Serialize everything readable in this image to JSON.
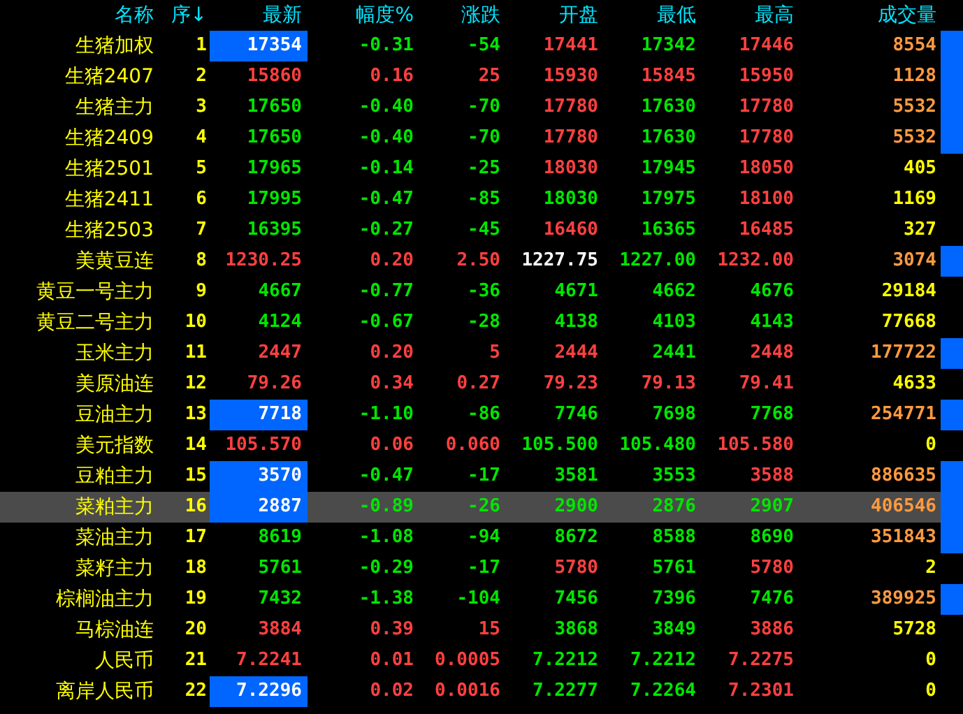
{
  "columns": [
    "名称",
    "序↓",
    "最新",
    "幅度%",
    "涨跌",
    "开盘",
    "最低",
    "最高",
    "成交量"
  ],
  "rows": [
    {
      "name": "生猪加权",
      "seq": "1",
      "latest_highlight": true,
      "volume_bar": true,
      "selected": false,
      "cells": [
        {
          "text": "17354",
          "color": "#ffffff"
        },
        {
          "text": "-0.31",
          "color": "#00e600"
        },
        {
          "text": "-54",
          "color": "#00e600"
        },
        {
          "text": "17441",
          "color": "#ff4040"
        },
        {
          "text": "17342",
          "color": "#00e600"
        },
        {
          "text": "17446",
          "color": "#ff4040"
        },
        {
          "text": "8554",
          "color": "#ff9a40"
        }
      ]
    },
    {
      "name": "生猪2407",
      "seq": "2",
      "latest_highlight": false,
      "volume_bar": true,
      "selected": false,
      "cells": [
        {
          "text": "15860",
          "color": "#ff4040"
        },
        {
          "text": "0.16",
          "color": "#ff4040"
        },
        {
          "text": "25",
          "color": "#ff4040"
        },
        {
          "text": "15930",
          "color": "#ff4040"
        },
        {
          "text": "15845",
          "color": "#ff4040"
        },
        {
          "text": "15950",
          "color": "#ff4040"
        },
        {
          "text": "1128",
          "color": "#ff9a40"
        }
      ]
    },
    {
      "name": "生猪主力",
      "seq": "3",
      "latest_highlight": false,
      "volume_bar": true,
      "selected": false,
      "cells": [
        {
          "text": "17650",
          "color": "#00e600"
        },
        {
          "text": "-0.40",
          "color": "#00e600"
        },
        {
          "text": "-70",
          "color": "#00e600"
        },
        {
          "text": "17780",
          "color": "#ff4040"
        },
        {
          "text": "17630",
          "color": "#00e600"
        },
        {
          "text": "17780",
          "color": "#ff4040"
        },
        {
          "text": "5532",
          "color": "#ff9a40"
        }
      ]
    },
    {
      "name": "生猪2409",
      "seq": "4",
      "latest_highlight": false,
      "volume_bar": true,
      "selected": false,
      "cells": [
        {
          "text": "17650",
          "color": "#00e600"
        },
        {
          "text": "-0.40",
          "color": "#00e600"
        },
        {
          "text": "-70",
          "color": "#00e600"
        },
        {
          "text": "17780",
          "color": "#ff4040"
        },
        {
          "text": "17630",
          "color": "#00e600"
        },
        {
          "text": "17780",
          "color": "#ff4040"
        },
        {
          "text": "5532",
          "color": "#ff9a40"
        }
      ]
    },
    {
      "name": "生猪2501",
      "seq": "5",
      "latest_highlight": false,
      "volume_bar": false,
      "selected": false,
      "cells": [
        {
          "text": "17965",
          "color": "#00e600"
        },
        {
          "text": "-0.14",
          "color": "#00e600"
        },
        {
          "text": "-25",
          "color": "#00e600"
        },
        {
          "text": "18030",
          "color": "#ff4040"
        },
        {
          "text": "17945",
          "color": "#00e600"
        },
        {
          "text": "18050",
          "color": "#ff4040"
        },
        {
          "text": "405",
          "color": "#ffff00"
        }
      ]
    },
    {
      "name": "生猪2411",
      "seq": "6",
      "latest_highlight": false,
      "volume_bar": false,
      "selected": false,
      "cells": [
        {
          "text": "17995",
          "color": "#00e600"
        },
        {
          "text": "-0.47",
          "color": "#00e600"
        },
        {
          "text": "-85",
          "color": "#00e600"
        },
        {
          "text": "18030",
          "color": "#00e600"
        },
        {
          "text": "17975",
          "color": "#00e600"
        },
        {
          "text": "18100",
          "color": "#ff4040"
        },
        {
          "text": "1169",
          "color": "#ffff00"
        }
      ]
    },
    {
      "name": "生猪2503",
      "seq": "7",
      "latest_highlight": false,
      "volume_bar": false,
      "selected": false,
      "cells": [
        {
          "text": "16395",
          "color": "#00e600"
        },
        {
          "text": "-0.27",
          "color": "#00e600"
        },
        {
          "text": "-45",
          "color": "#00e600"
        },
        {
          "text": "16460",
          "color": "#ff4040"
        },
        {
          "text": "16365",
          "color": "#00e600"
        },
        {
          "text": "16485",
          "color": "#ff4040"
        },
        {
          "text": "327",
          "color": "#ffff00"
        }
      ]
    },
    {
      "name": "美黄豆连",
      "seq": "8",
      "latest_highlight": false,
      "volume_bar": true,
      "selected": false,
      "cells": [
        {
          "text": "1230.25",
          "color": "#ff4040"
        },
        {
          "text": "0.20",
          "color": "#ff4040"
        },
        {
          "text": "2.50",
          "color": "#ff4040"
        },
        {
          "text": "1227.75",
          "color": "#ffffff"
        },
        {
          "text": "1227.00",
          "color": "#00e600"
        },
        {
          "text": "1232.00",
          "color": "#ff4040"
        },
        {
          "text": "3074",
          "color": "#ff9a40"
        }
      ]
    },
    {
      "name": "黄豆一号主力",
      "seq": "9",
      "latest_highlight": false,
      "volume_bar": false,
      "selected": false,
      "cells": [
        {
          "text": "4667",
          "color": "#00e600"
        },
        {
          "text": "-0.77",
          "color": "#00e600"
        },
        {
          "text": "-36",
          "color": "#00e600"
        },
        {
          "text": "4671",
          "color": "#00e600"
        },
        {
          "text": "4662",
          "color": "#00e600"
        },
        {
          "text": "4676",
          "color": "#00e600"
        },
        {
          "text": "29184",
          "color": "#ffff00"
        }
      ]
    },
    {
      "name": "黄豆二号主力",
      "seq": "10",
      "latest_highlight": false,
      "volume_bar": false,
      "selected": false,
      "cells": [
        {
          "text": "4124",
          "color": "#00e600"
        },
        {
          "text": "-0.67",
          "color": "#00e600"
        },
        {
          "text": "-28",
          "color": "#00e600"
        },
        {
          "text": "4138",
          "color": "#00e600"
        },
        {
          "text": "4103",
          "color": "#00e600"
        },
        {
          "text": "4143",
          "color": "#00e600"
        },
        {
          "text": "77668",
          "color": "#ffff00"
        }
      ]
    },
    {
      "name": "玉米主力",
      "seq": "11",
      "latest_highlight": false,
      "volume_bar": true,
      "selected": false,
      "cells": [
        {
          "text": "2447",
          "color": "#ff4040"
        },
        {
          "text": "0.20",
          "color": "#ff4040"
        },
        {
          "text": "5",
          "color": "#ff4040"
        },
        {
          "text": "2444",
          "color": "#ff4040"
        },
        {
          "text": "2441",
          "color": "#00e600"
        },
        {
          "text": "2448",
          "color": "#ff4040"
        },
        {
          "text": "177722",
          "color": "#ff9a40"
        }
      ]
    },
    {
      "name": "美原油连",
      "seq": "12",
      "latest_highlight": false,
      "volume_bar": false,
      "selected": false,
      "cells": [
        {
          "text": "79.26",
          "color": "#ff4040"
        },
        {
          "text": "0.34",
          "color": "#ff4040"
        },
        {
          "text": "0.27",
          "color": "#ff4040"
        },
        {
          "text": "79.23",
          "color": "#ff4040"
        },
        {
          "text": "79.13",
          "color": "#ff4040"
        },
        {
          "text": "79.41",
          "color": "#ff4040"
        },
        {
          "text": "4633",
          "color": "#ffff00"
        }
      ]
    },
    {
      "name": "豆油主力",
      "seq": "13",
      "latest_highlight": true,
      "volume_bar": true,
      "selected": false,
      "cells": [
        {
          "text": "7718",
          "color": "#ffffff"
        },
        {
          "text": "-1.10",
          "color": "#00e600"
        },
        {
          "text": "-86",
          "color": "#00e600"
        },
        {
          "text": "7746",
          "color": "#00e600"
        },
        {
          "text": "7698",
          "color": "#00e600"
        },
        {
          "text": "7768",
          "color": "#00e600"
        },
        {
          "text": "254771",
          "color": "#ff9a40"
        }
      ]
    },
    {
      "name": "美元指数",
      "seq": "14",
      "latest_highlight": false,
      "volume_bar": false,
      "selected": false,
      "cells": [
        {
          "text": "105.570",
          "color": "#ff4040"
        },
        {
          "text": "0.06",
          "color": "#ff4040"
        },
        {
          "text": "0.060",
          "color": "#ff4040"
        },
        {
          "text": "105.500",
          "color": "#00e600"
        },
        {
          "text": "105.480",
          "color": "#00e600"
        },
        {
          "text": "105.580",
          "color": "#ff4040"
        },
        {
          "text": "0",
          "color": "#ffff00"
        }
      ]
    },
    {
      "name": "豆粕主力",
      "seq": "15",
      "latest_highlight": true,
      "volume_bar": true,
      "selected": false,
      "cells": [
        {
          "text": "3570",
          "color": "#ffffff"
        },
        {
          "text": "-0.47",
          "color": "#00e600"
        },
        {
          "text": "-17",
          "color": "#00e600"
        },
        {
          "text": "3581",
          "color": "#00e600"
        },
        {
          "text": "3553",
          "color": "#00e600"
        },
        {
          "text": "3588",
          "color": "#ff4040"
        },
        {
          "text": "886635",
          "color": "#ff9a40"
        }
      ]
    },
    {
      "name": "菜粕主力",
      "seq": "16",
      "latest_highlight": true,
      "volume_bar": true,
      "selected": true,
      "cells": [
        {
          "text": "2887",
          "color": "#ffffff"
        },
        {
          "text": "-0.89",
          "color": "#00e600"
        },
        {
          "text": "-26",
          "color": "#00e600"
        },
        {
          "text": "2900",
          "color": "#00e600"
        },
        {
          "text": "2876",
          "color": "#00e600"
        },
        {
          "text": "2907",
          "color": "#00e600"
        },
        {
          "text": "406546",
          "color": "#ff9a40"
        }
      ]
    },
    {
      "name": "菜油主力",
      "seq": "17",
      "latest_highlight": false,
      "volume_bar": true,
      "selected": false,
      "cells": [
        {
          "text": "8619",
          "color": "#00e600"
        },
        {
          "text": "-1.08",
          "color": "#00e600"
        },
        {
          "text": "-94",
          "color": "#00e600"
        },
        {
          "text": "8672",
          "color": "#00e600"
        },
        {
          "text": "8588",
          "color": "#00e600"
        },
        {
          "text": "8690",
          "color": "#00e600"
        },
        {
          "text": "351843",
          "color": "#ff9a40"
        }
      ]
    },
    {
      "name": "菜籽主力",
      "seq": "18",
      "latest_highlight": false,
      "volume_bar": false,
      "selected": false,
      "cells": [
        {
          "text": "5761",
          "color": "#00e600"
        },
        {
          "text": "-0.29",
          "color": "#00e600"
        },
        {
          "text": "-17",
          "color": "#00e600"
        },
        {
          "text": "5780",
          "color": "#ff4040"
        },
        {
          "text": "5761",
          "color": "#00e600"
        },
        {
          "text": "5780",
          "color": "#ff4040"
        },
        {
          "text": "2",
          "color": "#ffff00"
        }
      ]
    },
    {
      "name": "棕榈油主力",
      "seq": "19",
      "latest_highlight": false,
      "volume_bar": true,
      "selected": false,
      "cells": [
        {
          "text": "7432",
          "color": "#00e600"
        },
        {
          "text": "-1.38",
          "color": "#00e600"
        },
        {
          "text": "-104",
          "color": "#00e600"
        },
        {
          "text": "7456",
          "color": "#00e600"
        },
        {
          "text": "7396",
          "color": "#00e600"
        },
        {
          "text": "7476",
          "color": "#00e600"
        },
        {
          "text": "389925",
          "color": "#ff9a40"
        }
      ]
    },
    {
      "name": "马棕油连",
      "seq": "20",
      "latest_highlight": false,
      "volume_bar": false,
      "selected": false,
      "cells": [
        {
          "text": "3884",
          "color": "#ff4040"
        },
        {
          "text": "0.39",
          "color": "#ff4040"
        },
        {
          "text": "15",
          "color": "#ff4040"
        },
        {
          "text": "3868",
          "color": "#00e600"
        },
        {
          "text": "3849",
          "color": "#00e600"
        },
        {
          "text": "3886",
          "color": "#ff4040"
        },
        {
          "text": "5728",
          "color": "#ffff00"
        }
      ]
    },
    {
      "name": "人民币",
      "seq": "21",
      "latest_highlight": false,
      "volume_bar": false,
      "selected": false,
      "cells": [
        {
          "text": "7.2241",
          "color": "#ff4040"
        },
        {
          "text": "0.01",
          "color": "#ff4040"
        },
        {
          "text": "0.0005",
          "color": "#ff4040"
        },
        {
          "text": "7.2212",
          "color": "#00e600"
        },
        {
          "text": "7.2212",
          "color": "#00e600"
        },
        {
          "text": "7.2275",
          "color": "#ff4040"
        },
        {
          "text": "0",
          "color": "#ffff00"
        }
      ]
    },
    {
      "name": "离岸人民币",
      "seq": "22",
      "latest_highlight": true,
      "volume_bar": false,
      "selected": false,
      "cells": [
        {
          "text": "7.2296",
          "color": "#ffffff"
        },
        {
          "text": "0.02",
          "color": "#ff4040"
        },
        {
          "text": "0.0016",
          "color": "#ff4040"
        },
        {
          "text": "7.2277",
          "color": "#00e600"
        },
        {
          "text": "7.2264",
          "color": "#00e600"
        },
        {
          "text": "7.2301",
          "color": "#ff4040"
        },
        {
          "text": "0",
          "color": "#ffff00"
        }
      ]
    }
  ]
}
